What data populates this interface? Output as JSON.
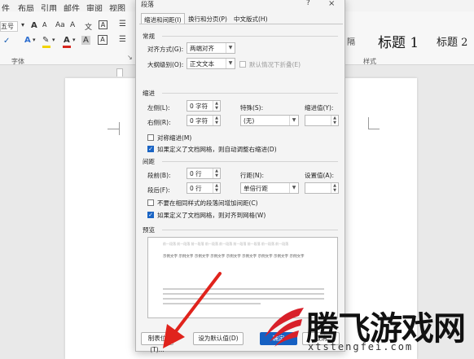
{
  "ribbon": {
    "tabs": [
      "件",
      "布局",
      "引用",
      "邮件",
      "审阅",
      "视图"
    ],
    "font_size": "五号",
    "font_group_label": "字体",
    "styles_group_label": "样式",
    "style_items": [
      "标题 1",
      "标题 2"
    ],
    "style_partial": "隔",
    "colors": {
      "highlight": "#f2d400",
      "font_color": "#d7261e"
    }
  },
  "dialog": {
    "title": "段落",
    "help_label": "?",
    "close_label": "×",
    "tabs": [
      "缩进和间距(I)",
      "换行和分页(P)",
      "中文版式(H)"
    ],
    "general": {
      "section": "常规",
      "alignment_label": "对齐方式(G):",
      "alignment_value": "两端对齐",
      "outline_label": "大纲级别(O):",
      "outline_value": "正文文本",
      "collapse_label": "默认情况下折叠(E)"
    },
    "indent": {
      "section": "缩进",
      "left_label": "左侧(L):",
      "left_value": "0 字符",
      "right_label": "右侧(R):",
      "right_value": "0 字符",
      "special_label": "特殊(S):",
      "special_value": "(无)",
      "indent_by_label": "缩进值(Y):",
      "indent_by_value": "",
      "mirror_label": "对称缩进(M)",
      "auto_adjust_label": "如果定义了文档网格，则自动调整右缩进(D)"
    },
    "spacing": {
      "section": "间距",
      "before_label": "段前(B):",
      "before_value": "0 行",
      "after_label": "段后(F):",
      "after_value": "0 行",
      "line_spacing_label": "行距(N):",
      "line_spacing_value": "单倍行距",
      "at_label": "设置值(A):",
      "at_value": "",
      "no_space_label": "不要在相同样式的段落间增加间距(C)",
      "snap_grid_label": "如果定义了文档网格，则对齐到网格(W)"
    },
    "preview": {
      "section": "预览",
      "prev_text": "前一段落 前一段落 前一段落 前一段落 前一段落 前一段落 前一段落 前一段落 前一段落",
      "sample_text": "示例文字 示例文字 示例文字 示例文字 示例文字 示例文字 示例文字 示例文字 示例文字"
    },
    "buttons": {
      "tabs": "制表位(T)...",
      "default": "设为默认值(D)",
      "ok": "确定",
      "cancel": "取消"
    }
  },
  "watermark": {
    "text": "腾飞游戏网",
    "url": "xtstengfei.com"
  },
  "colors": {
    "accent": "#1660c2",
    "arrow": "#e0231c",
    "watermark_red": "#d8202a"
  }
}
